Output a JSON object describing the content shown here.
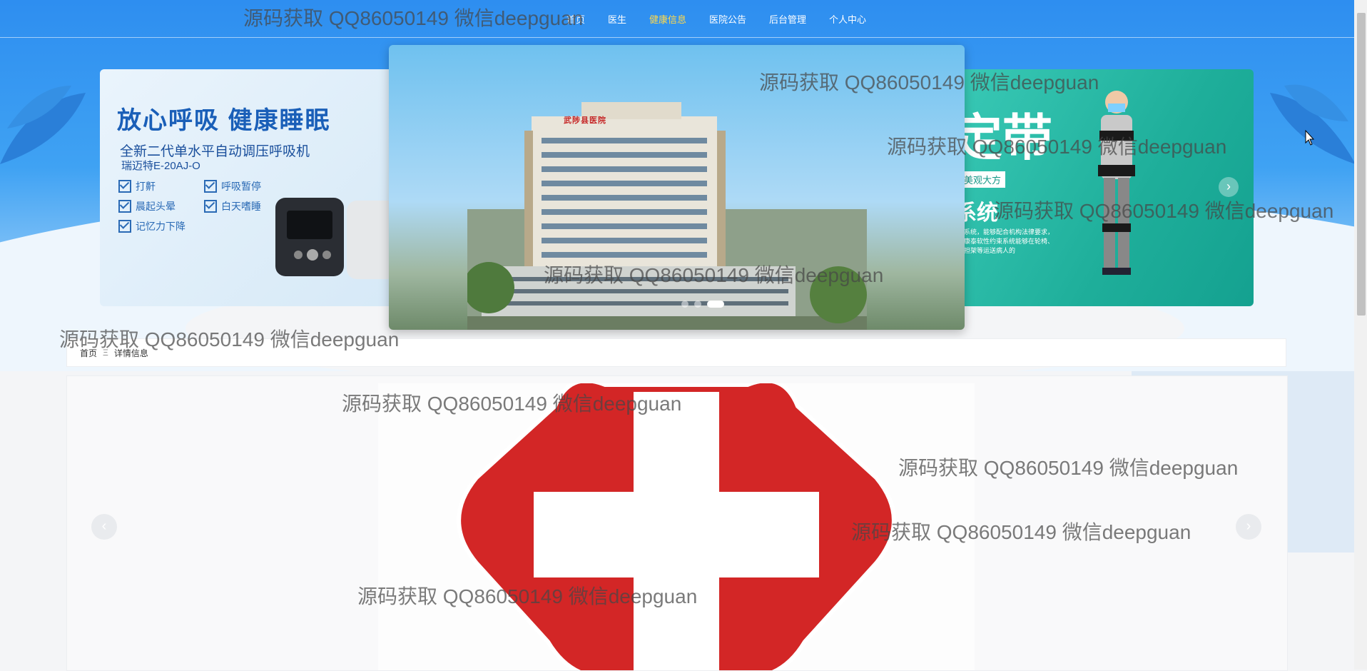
{
  "nav": {
    "items": [
      {
        "label": "首页",
        "active": false
      },
      {
        "label": "医生",
        "active": false
      },
      {
        "label": "健康信息",
        "active": true
      },
      {
        "label": "医院公告",
        "active": false
      },
      {
        "label": "后台管理",
        "active": false
      },
      {
        "label": "个人中心",
        "active": false
      }
    ]
  },
  "carousel": {
    "left": {
      "title": "放心呼吸 健康睡眠",
      "subtitle": "全新二代单水平自动调压呼吸机",
      "model": "瑞迈特E-20AJ-O",
      "features": [
        "打鼾",
        "呼吸暂停",
        "晨起头晕",
        "白天嗜睡",
        "记忆力下降"
      ]
    },
    "right": {
      "title": "定带",
      "tag": "美观大方",
      "system": "系统",
      "text": "系统，能够配合机构法律要求，康泰软性约束系统能够在轮椅、担架等运送病人的"
    },
    "building_sign": "武陟县医院",
    "next_icon": "chevron-right-icon",
    "slides_count": 3,
    "active_slide": 3
  },
  "breadcrumb": {
    "home": "首页",
    "separator": "Ξ",
    "current": "详情信息"
  },
  "detail": {
    "prev_icon": "chevron-left-icon",
    "next_icon": "chevron-right-icon"
  },
  "watermark": {
    "text": "源码获取 QQ86050149 微信deepguan"
  },
  "colors": {
    "nav_active": "#ffd94a",
    "banner_blue": "#2e8ef0",
    "cross_red": "#d32626"
  }
}
